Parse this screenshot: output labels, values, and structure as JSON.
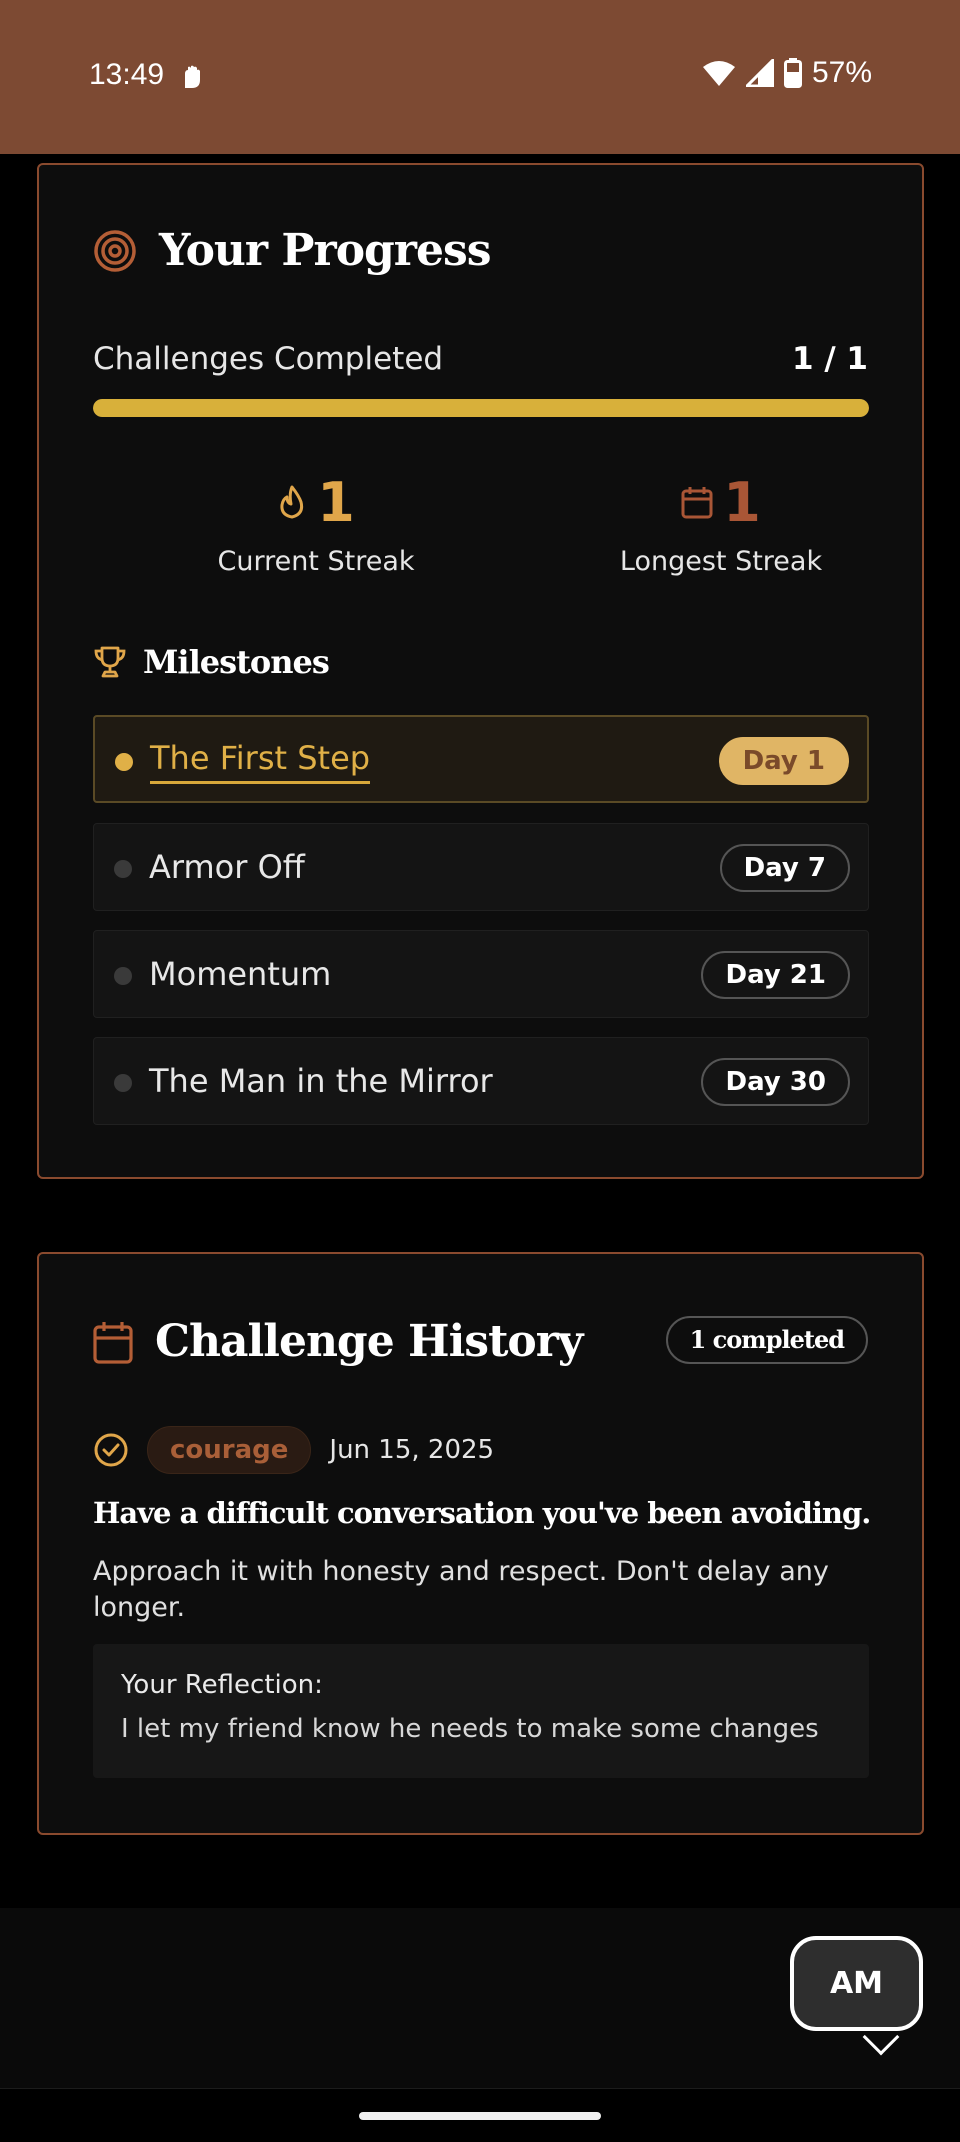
{
  "status_bar": {
    "time": "13:49",
    "battery": "57%"
  },
  "progress": {
    "title": "Your Progress",
    "challenges_label": "Challenges Completed",
    "challenges_count": "1 / 1",
    "progress_fraction": 1.0,
    "current_streak": {
      "value": "1",
      "label": "Current Streak"
    },
    "longest_streak": {
      "value": "1",
      "label": "Longest Streak"
    },
    "milestones_title": "Milestones",
    "milestones": [
      {
        "label": "The First Step",
        "day": "Day 1",
        "achieved": true
      },
      {
        "label": "Armor Off",
        "day": "Day 7",
        "achieved": false
      },
      {
        "label": "Momentum",
        "day": "Day 21",
        "achieved": false
      },
      {
        "label": "The Man in the Mirror",
        "day": "Day 30",
        "achieved": false
      }
    ]
  },
  "history": {
    "title": "Challenge History",
    "badge": "1 completed",
    "items": [
      {
        "tag": "courage",
        "date": "Jun 15, 2025",
        "title": "Have a difficult conversation you've been avoiding.",
        "description": "Approach it with honesty and respect. Don't delay any longer.",
        "reflection_label": "Your Reflection:",
        "reflection": "I let my friend know he needs to make some changes"
      }
    ]
  },
  "avatar": {
    "initials": "AM"
  },
  "colors": {
    "accent": "#b45e36",
    "gold": "#d8b03a",
    "status_bar": "#7d4a33"
  }
}
